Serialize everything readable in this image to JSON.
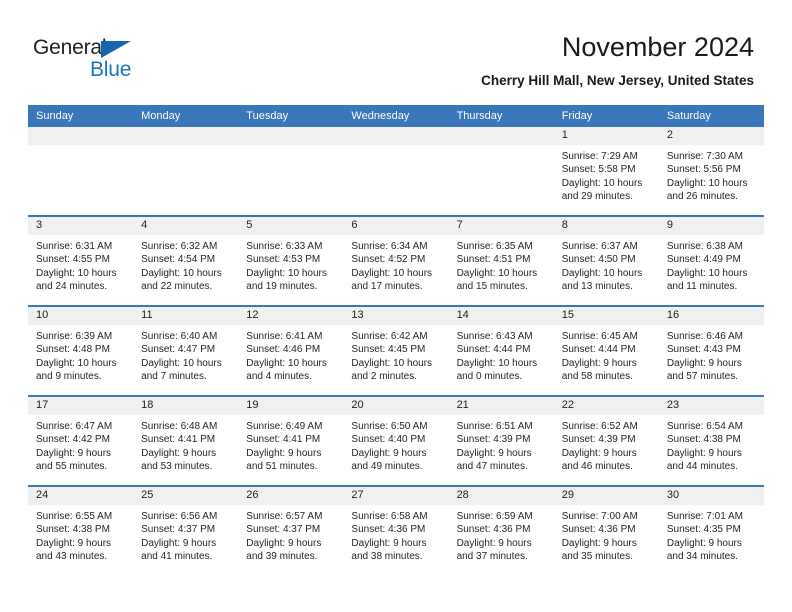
{
  "brand": {
    "word_one": "General",
    "word_two": "Blue",
    "triangle_color": "#1565b0",
    "blue_color": "#1b75bb"
  },
  "header": {
    "title": "November 2024",
    "subtitle": "Cherry Hill Mall, New Jersey, United States",
    "header_bg": "#3a76ba",
    "daynum_bg": "#f0f0f0"
  },
  "weekday_headers": [
    "Sunday",
    "Monday",
    "Tuesday",
    "Wednesday",
    "Thursday",
    "Friday",
    "Saturday"
  ],
  "weeks": [
    [
      {
        "day": "",
        "empty": true
      },
      {
        "day": "",
        "empty": true
      },
      {
        "day": "",
        "empty": true
      },
      {
        "day": "",
        "empty": true
      },
      {
        "day": "",
        "empty": true
      },
      {
        "day": "1",
        "sunrise": "Sunrise: 7:29 AM",
        "sunset": "Sunset: 5:58 PM",
        "daylight": "Daylight: 10 hours and 29 minutes."
      },
      {
        "day": "2",
        "sunrise": "Sunrise: 7:30 AM",
        "sunset": "Sunset: 5:56 PM",
        "daylight": "Daylight: 10 hours and 26 minutes."
      }
    ],
    [
      {
        "day": "3",
        "sunrise": "Sunrise: 6:31 AM",
        "sunset": "Sunset: 4:55 PM",
        "daylight": "Daylight: 10 hours and 24 minutes."
      },
      {
        "day": "4",
        "sunrise": "Sunrise: 6:32 AM",
        "sunset": "Sunset: 4:54 PM",
        "daylight": "Daylight: 10 hours and 22 minutes."
      },
      {
        "day": "5",
        "sunrise": "Sunrise: 6:33 AM",
        "sunset": "Sunset: 4:53 PM",
        "daylight": "Daylight: 10 hours and 19 minutes."
      },
      {
        "day": "6",
        "sunrise": "Sunrise: 6:34 AM",
        "sunset": "Sunset: 4:52 PM",
        "daylight": "Daylight: 10 hours and 17 minutes."
      },
      {
        "day": "7",
        "sunrise": "Sunrise: 6:35 AM",
        "sunset": "Sunset: 4:51 PM",
        "daylight": "Daylight: 10 hours and 15 minutes."
      },
      {
        "day": "8",
        "sunrise": "Sunrise: 6:37 AM",
        "sunset": "Sunset: 4:50 PM",
        "daylight": "Daylight: 10 hours and 13 minutes."
      },
      {
        "day": "9",
        "sunrise": "Sunrise: 6:38 AM",
        "sunset": "Sunset: 4:49 PM",
        "daylight": "Daylight: 10 hours and 11 minutes."
      }
    ],
    [
      {
        "day": "10",
        "sunrise": "Sunrise: 6:39 AM",
        "sunset": "Sunset: 4:48 PM",
        "daylight": "Daylight: 10 hours and 9 minutes."
      },
      {
        "day": "11",
        "sunrise": "Sunrise: 6:40 AM",
        "sunset": "Sunset: 4:47 PM",
        "daylight": "Daylight: 10 hours and 7 minutes."
      },
      {
        "day": "12",
        "sunrise": "Sunrise: 6:41 AM",
        "sunset": "Sunset: 4:46 PM",
        "daylight": "Daylight: 10 hours and 4 minutes."
      },
      {
        "day": "13",
        "sunrise": "Sunrise: 6:42 AM",
        "sunset": "Sunset: 4:45 PM",
        "daylight": "Daylight: 10 hours and 2 minutes."
      },
      {
        "day": "14",
        "sunrise": "Sunrise: 6:43 AM",
        "sunset": "Sunset: 4:44 PM",
        "daylight": "Daylight: 10 hours and 0 minutes."
      },
      {
        "day": "15",
        "sunrise": "Sunrise: 6:45 AM",
        "sunset": "Sunset: 4:44 PM",
        "daylight": "Daylight: 9 hours and 58 minutes."
      },
      {
        "day": "16",
        "sunrise": "Sunrise: 6:46 AM",
        "sunset": "Sunset: 4:43 PM",
        "daylight": "Daylight: 9 hours and 57 minutes."
      }
    ],
    [
      {
        "day": "17",
        "sunrise": "Sunrise: 6:47 AM",
        "sunset": "Sunset: 4:42 PM",
        "daylight": "Daylight: 9 hours and 55 minutes."
      },
      {
        "day": "18",
        "sunrise": "Sunrise: 6:48 AM",
        "sunset": "Sunset: 4:41 PM",
        "daylight": "Daylight: 9 hours and 53 minutes."
      },
      {
        "day": "19",
        "sunrise": "Sunrise: 6:49 AM",
        "sunset": "Sunset: 4:41 PM",
        "daylight": "Daylight: 9 hours and 51 minutes."
      },
      {
        "day": "20",
        "sunrise": "Sunrise: 6:50 AM",
        "sunset": "Sunset: 4:40 PM",
        "daylight": "Daylight: 9 hours and 49 minutes."
      },
      {
        "day": "21",
        "sunrise": "Sunrise: 6:51 AM",
        "sunset": "Sunset: 4:39 PM",
        "daylight": "Daylight: 9 hours and 47 minutes."
      },
      {
        "day": "22",
        "sunrise": "Sunrise: 6:52 AM",
        "sunset": "Sunset: 4:39 PM",
        "daylight": "Daylight: 9 hours and 46 minutes."
      },
      {
        "day": "23",
        "sunrise": "Sunrise: 6:54 AM",
        "sunset": "Sunset: 4:38 PM",
        "daylight": "Daylight: 9 hours and 44 minutes."
      }
    ],
    [
      {
        "day": "24",
        "sunrise": "Sunrise: 6:55 AM",
        "sunset": "Sunset: 4:38 PM",
        "daylight": "Daylight: 9 hours and 43 minutes."
      },
      {
        "day": "25",
        "sunrise": "Sunrise: 6:56 AM",
        "sunset": "Sunset: 4:37 PM",
        "daylight": "Daylight: 9 hours and 41 minutes."
      },
      {
        "day": "26",
        "sunrise": "Sunrise: 6:57 AM",
        "sunset": "Sunset: 4:37 PM",
        "daylight": "Daylight: 9 hours and 39 minutes."
      },
      {
        "day": "27",
        "sunrise": "Sunrise: 6:58 AM",
        "sunset": "Sunset: 4:36 PM",
        "daylight": "Daylight: 9 hours and 38 minutes."
      },
      {
        "day": "28",
        "sunrise": "Sunrise: 6:59 AM",
        "sunset": "Sunset: 4:36 PM",
        "daylight": "Daylight: 9 hours and 37 minutes."
      },
      {
        "day": "29",
        "sunrise": "Sunrise: 7:00 AM",
        "sunset": "Sunset: 4:36 PM",
        "daylight": "Daylight: 9 hours and 35 minutes."
      },
      {
        "day": "30",
        "sunrise": "Sunrise: 7:01 AM",
        "sunset": "Sunset: 4:35 PM",
        "daylight": "Daylight: 9 hours and 34 minutes."
      }
    ]
  ]
}
